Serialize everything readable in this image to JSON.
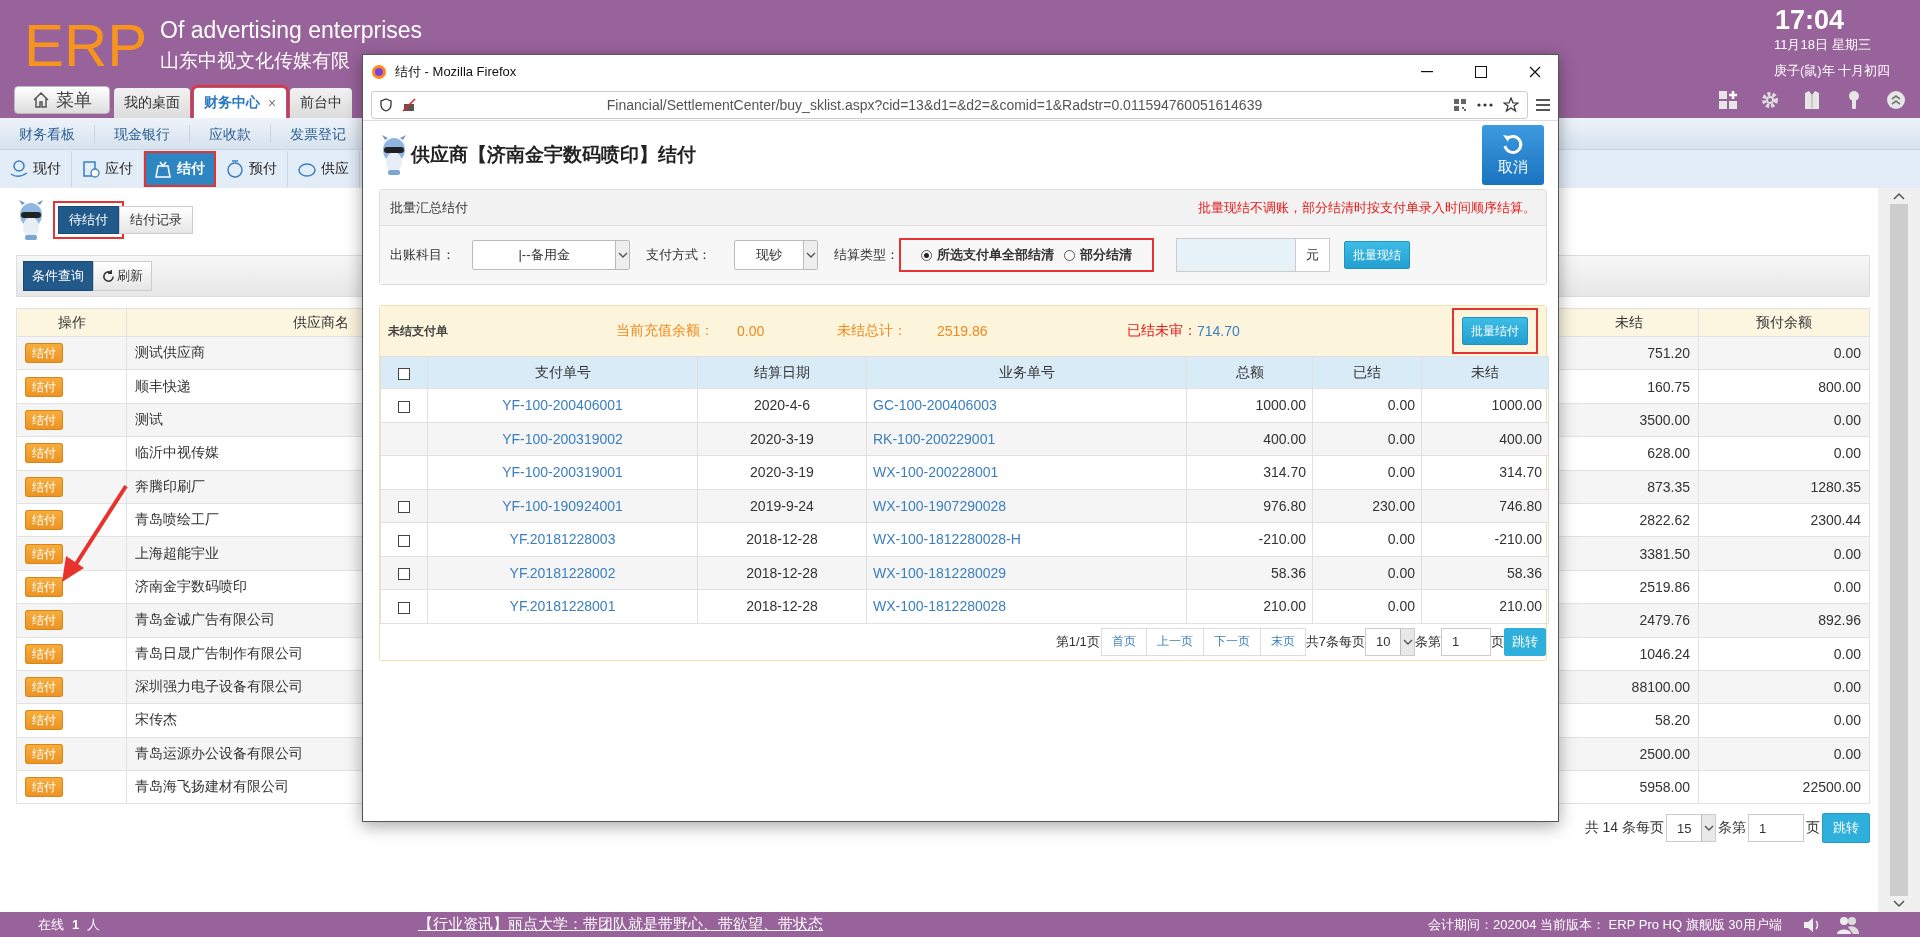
{
  "header": {
    "logo": "ERP",
    "tagline": "Of advertising enterprises",
    "company": "山东中视文化传媒有限",
    "time": "17:04",
    "date": "11月18日 星期三",
    "lunar": "庚子(鼠)年 十月初四"
  },
  "menu_button": "菜单",
  "tabs": [
    {
      "label": "我的桌面",
      "selected": false,
      "highlighted": false
    },
    {
      "label": "财务中心",
      "selected": true,
      "highlighted": true,
      "close": "×"
    },
    {
      "label": "前台中",
      "selected": false,
      "highlighted": false
    }
  ],
  "subnav": [
    "财务看板",
    "现金银行",
    "应收款",
    "发票登记"
  ],
  "toolbar": [
    {
      "label": "现付",
      "selected": false,
      "highlighted": false
    },
    {
      "label": "应付",
      "selected": false,
      "highlighted": false
    },
    {
      "label": "结付",
      "selected": true,
      "highlighted": true
    },
    {
      "label": "预付",
      "selected": false,
      "highlighted": false
    },
    {
      "label": "供应",
      "selected": false,
      "highlighted": false
    }
  ],
  "view_tabs": [
    {
      "label": "待结付",
      "selected": true,
      "highlighted": true
    },
    {
      "label": "结付记录",
      "selected": false,
      "highlighted": false
    }
  ],
  "query_buttons": [
    {
      "label": "条件查询",
      "kind": "primary"
    },
    {
      "label": "刷新",
      "kind": "refresh"
    }
  ],
  "supplier_table": {
    "columns": [
      "操作",
      "供应商名",
      "未结",
      "预付余额"
    ],
    "rows": [
      {
        "action": "结付",
        "name": "测试供应商",
        "unsettled": "751.20",
        "prepaid": "0.00"
      },
      {
        "action": "结付",
        "name": "顺丰快递",
        "unsettled": "160.75",
        "prepaid": "800.00"
      },
      {
        "action": "结付",
        "name": "测试",
        "unsettled": "3500.00",
        "prepaid": "0.00"
      },
      {
        "action": "结付",
        "name": "临沂中视传媒",
        "unsettled": "628.00",
        "prepaid": "0.00"
      },
      {
        "action": "结付",
        "name": "奔腾印刷厂",
        "unsettled": "873.35",
        "prepaid": "1280.35"
      },
      {
        "action": "结付",
        "name": "青岛喷绘工厂",
        "unsettled": "2822.62",
        "prepaid": "2300.44"
      },
      {
        "action": "结付",
        "name": "上海超能宇业",
        "unsettled": "3381.50",
        "prepaid": "0.00"
      },
      {
        "action": "结付",
        "name": "济南金宇数码喷印",
        "unsettled": "2519.86",
        "prepaid": "0.00"
      },
      {
        "action": "结付",
        "name": "青岛金诚广告有限公司",
        "unsettled": "2479.76",
        "prepaid": "892.96"
      },
      {
        "action": "结付",
        "name": "青岛日晟广告制作有限公司",
        "unsettled": "1046.24",
        "prepaid": "0.00"
      },
      {
        "action": "结付",
        "name": "深圳强力电子设备有限公司",
        "unsettled": "88100.00",
        "prepaid": "0.00"
      },
      {
        "action": "结付",
        "name": "宋传杰",
        "unsettled": "58.20",
        "prepaid": "0.00"
      },
      {
        "action": "结付",
        "name": "青岛运源办公设备有限公司",
        "unsettled": "2500.00",
        "prepaid": "0.00"
      },
      {
        "action": "结付",
        "name": "青岛海飞扬建材有限公司",
        "unsettled": "5958.00",
        "prepaid": "22500.00"
      }
    ]
  },
  "pagination": {
    "summary": "共 14 条每页",
    "page_size": "15",
    "page_label": "条第",
    "page": "1",
    "page_suffix": "页",
    "go": "跳转"
  },
  "popup": {
    "window_title": "结付 - Mozilla Firefox",
    "url": "Financial/SettlementCenter/buy_sklist.aspx?cid=13&d1=&d2=&comid=1&Radstr=0.011594760051614639",
    "heading": "供应商【济南金宇数码喷印】结付",
    "cancel": "取消",
    "batch_panel": {
      "title": "批量汇总结付",
      "note": "批量现结不调账，部分结清时按支付单录入时间顺序结算。",
      "account_label": "出账科目：",
      "account_value": "|--备用金",
      "method_label": "支付方式：",
      "method_value": "现钞",
      "type_label": "结算类型：",
      "type_highlighted": true,
      "type_options": [
        {
          "label": "所选支付单全部结清",
          "selected": true
        },
        {
          "label": "部分结清",
          "selected": false
        }
      ],
      "amount_unit": "元",
      "cash_button": "批量现结"
    },
    "summary": {
      "title": "未结支付单",
      "balance_label": "当前充值余额：",
      "balance": "0.00",
      "total_label": "未结总计：",
      "total": "2519.86",
      "pending_label": "已结未审：",
      "pending": "714.70",
      "batch_button": "批量结付",
      "batch_highlighted": true
    },
    "table": {
      "all_checked": false,
      "columns": [
        "支付单号",
        "结算日期",
        "业务单号",
        "总额",
        "已结",
        "未结"
      ],
      "rows": [
        {
          "selectable": true,
          "checked": false,
          "cells": [
            "YF-100-200406001",
            "2020-4-6",
            "GC-100-200406003",
            "1000.00",
            "0.00",
            "1000.00"
          ]
        },
        {
          "selectable": false,
          "cells": [
            "YF-100-200319002",
            "2020-3-19",
            "RK-100-200229001",
            "400.00",
            "0.00",
            "400.00"
          ]
        },
        {
          "selectable": false,
          "cells": [
            "YF-100-200319001",
            "2020-3-19",
            "WX-100-200228001",
            "314.70",
            "0.00",
            "314.70"
          ]
        },
        {
          "selectable": true,
          "checked": false,
          "cells": [
            "YF-100-190924001",
            "2019-9-24",
            "WX-100-1907290028",
            "976.80",
            "230.00",
            "746.80"
          ]
        },
        {
          "selectable": true,
          "checked": false,
          "cells": [
            "YF.20181228003",
            "2018-12-28",
            "WX-100-1812280028-H",
            "-210.00",
            "0.00",
            "-210.00"
          ]
        },
        {
          "selectable": true,
          "checked": false,
          "cells": [
            "YF.20181228002",
            "2018-12-28",
            "WX-100-1812280029",
            "58.36",
            "0.00",
            "58.36"
          ]
        },
        {
          "selectable": true,
          "checked": false,
          "cells": [
            "YF.20181228001",
            "2018-12-28",
            "WX-100-1812280028",
            "210.00",
            "0.00",
            "210.00"
          ]
        }
      ]
    },
    "pagination": {
      "page_info": "第1/1页",
      "buttons": [
        "首页",
        "上一页",
        "下一页",
        "末页"
      ],
      "summary": "共7条每页",
      "page_size": "10",
      "page_label": "条第",
      "page": "1",
      "page_suffix": "页",
      "go": "跳转"
    }
  },
  "status_bar": {
    "online_label": "在线",
    "online_count": "1",
    "online_unit": "人",
    "news": "【行业资讯】丽点大学：带团队就是带野心、带欲望、带状态",
    "info": "会计期间：202004 当前版本： ERP Pro HQ 旗舰版 30用户端"
  }
}
